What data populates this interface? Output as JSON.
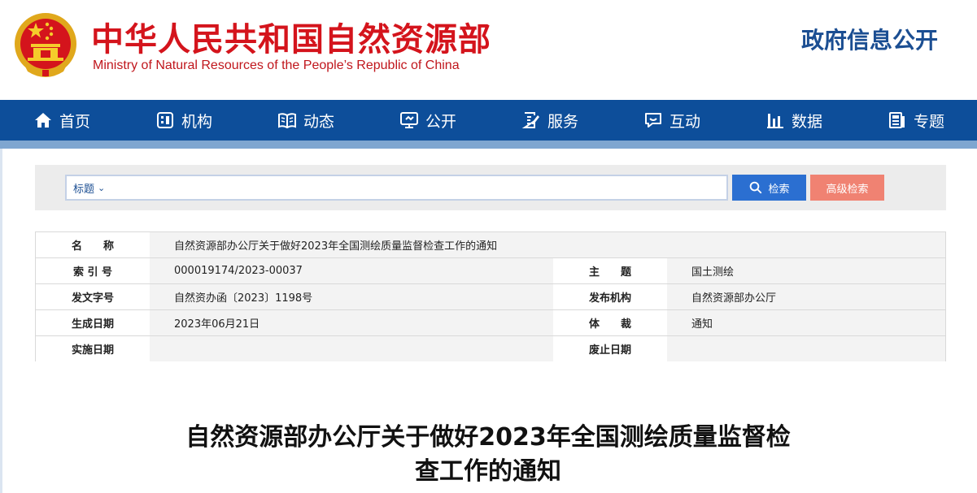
{
  "header": {
    "title_cn": "中华人民共和国自然资源部",
    "title_en": "Ministry of Natural Resources of the People’s Republic of China",
    "section": "政府信息公开",
    "emblem_icon": "national-emblem-icon"
  },
  "colors": {
    "brand_red": "#d4141c",
    "nav_blue": "#0d4e9a",
    "search_blue": "#2b6fd1",
    "advanced_salmon": "#f08272"
  },
  "nav": [
    {
      "label": "首页",
      "icon": "home-icon"
    },
    {
      "label": "机构",
      "icon": "organization-icon"
    },
    {
      "label": "动态",
      "icon": "book-icon"
    },
    {
      "label": "公开",
      "icon": "monitor-icon"
    },
    {
      "label": "服务",
      "icon": "edit-document-icon"
    },
    {
      "label": "互动",
      "icon": "chat-icon"
    },
    {
      "label": "数据",
      "icon": "bar-chart-icon"
    },
    {
      "label": "专题",
      "icon": "topic-icon"
    }
  ],
  "search": {
    "scope": "标题",
    "query": "",
    "search_label": "检索",
    "advanced_label": "高级检索"
  },
  "meta": {
    "name_label": "名　　称",
    "name_value": "自然资源部办公厅关于做好2023年全国测绘质量监督检查工作的通知",
    "index_label": "索 引 号",
    "index_value": "000019174/2023-00037",
    "subject_label": "主　　题",
    "subject_value": "国土测绘",
    "docno_label": "发文字号",
    "docno_value": "自然资办函〔2023〕1198号",
    "issuer_label": "发布机构",
    "issuer_value": "自然资源部办公厅",
    "date_label": "生成日期",
    "date_value": "2023年06月21日",
    "genre_label": "体　　裁",
    "genre_value": "通知",
    "effective_label": "实施日期",
    "effective_value": "",
    "expire_label": "废止日期",
    "expire_value": ""
  },
  "document": {
    "title_line1": "自然资源部办公厅关于做好2023年全国测绘质量监督检",
    "title_line2": "查工作的通知"
  }
}
